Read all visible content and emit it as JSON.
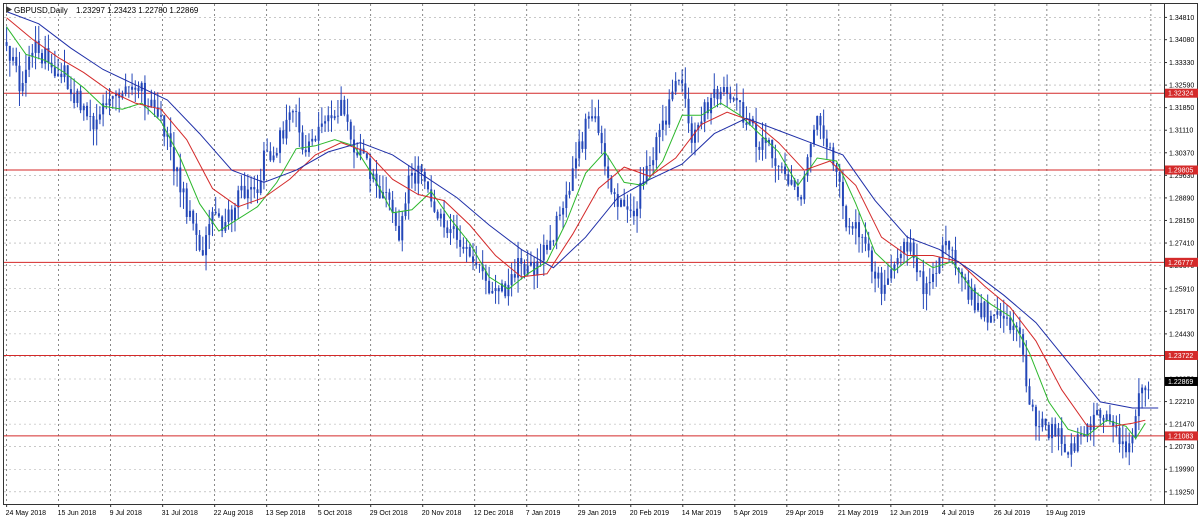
{
  "header": {
    "symbol": "GBPUSD,Daily",
    "ohlc": "1.23297 1.23423 1.22780 1.22869"
  },
  "colors": {
    "background": "#ffffff",
    "candle": "#2447b8",
    "ma_fast": "#2db82d",
    "ma_mid": "#d42a2a",
    "ma_slow": "#1f2fa8",
    "level_line": "#d42a2a",
    "level_tag": "#d42a2a",
    "current_tag": "#000000",
    "grid": "#a8a8a8"
  },
  "chart_data": {
    "type": "candlestick",
    "ylim": [
      1.1885,
      1.3525
    ],
    "y_ticks": [
      1.3481,
      1.3408,
      1.3333,
      1.3259,
      1.3185,
      1.3111,
      1.3037,
      1.2963,
      1.2889,
      1.2815,
      1.2741,
      1.2667,
      1.2591,
      1.2517,
      1.2443,
      1.2369,
      1.2295,
      1.2221,
      1.2147,
      1.2073,
      1.1999,
      1.1925
    ],
    "y_tick_labels": [
      "1.34810",
      "1.34080",
      "1.33330",
      "1.32590",
      "1.31850",
      "1.31110",
      "1.30370",
      "1.29630",
      "1.28890",
      "1.28150",
      "1.27410",
      "1.26670",
      "1.25910",
      "1.25170",
      "1.24430",
      "1.23690",
      "1.22950",
      "1.22210",
      "1.21470",
      "1.20730",
      "1.19990",
      "1.19250"
    ],
    "x_labels": [
      "24 May 2018",
      "15 Jun 2018",
      "9 Jul 2018",
      "31 Jul 2018",
      "22 Aug 2018",
      "13 Sep 2018",
      "5 Oct 2018",
      "29 Oct 2018",
      "20 Nov 2018",
      "12 Dec 2018",
      "7 Jan 2019",
      "29 Jan 2019",
      "20 Feb 2019",
      "14 Mar 2019",
      "5 Apr 2019",
      "29 Apr 2019",
      "21 May 2019",
      "12 Jun 2019",
      "4 Jul 2019",
      "26 Jul 2019",
      "19 Aug 2019"
    ],
    "horizontal_levels": [
      {
        "value": 1.32324,
        "label": "1.32324"
      },
      {
        "value": 1.29805,
        "label": "1.29805"
      },
      {
        "value": 1.26777,
        "label": "1.26777"
      },
      {
        "value": 1.23722,
        "label": "1.23722"
      },
      {
        "value": 1.21083,
        "label": "1.21083"
      }
    ],
    "current_price": {
      "value": 1.22869,
      "label": "1.22869"
    },
    "grid": true,
    "legend": "none",
    "series": [
      {
        "kind": "candles",
        "close_path": [
          [
            0,
            1.34
          ],
          [
            4,
            1.326
          ],
          [
            8,
            1.338
          ],
          [
            12,
            1.335
          ],
          [
            15,
            1.332
          ],
          [
            18,
            1.329
          ],
          [
            21,
            1.323
          ],
          [
            25,
            1.318
          ],
          [
            28,
            1.312
          ],
          [
            31,
            1.32
          ],
          [
            35,
            1.322
          ],
          [
            39,
            1.326
          ],
          [
            42,
            1.324
          ],
          [
            45,
            1.318
          ],
          [
            48,
            1.314
          ],
          [
            52,
            1.3
          ],
          [
            55,
            1.29
          ],
          [
            58,
            1.278
          ],
          [
            61,
            1.27
          ],
          [
            64,
            1.282
          ],
          [
            67,
            1.278
          ],
          [
            70,
            1.284
          ],
          [
            73,
            1.293
          ],
          [
            77,
            1.29
          ],
          [
            80,
            1.301
          ],
          [
            84,
            1.305
          ],
          [
            87,
            1.313
          ],
          [
            90,
            1.318
          ],
          [
            93,
            1.302
          ],
          [
            96,
            1.308
          ],
          [
            100,
            1.315
          ],
          [
            104,
            1.319
          ],
          [
            107,
            1.309
          ],
          [
            110,
            1.304
          ],
          [
            113,
            1.297
          ],
          [
            116,
            1.292
          ],
          [
            119,
            1.285
          ],
          [
            122,
            1.272
          ],
          [
            125,
            1.295
          ],
          [
            128,
            1.298
          ],
          [
            131,
            1.293
          ],
          [
            134,
            1.285
          ],
          [
            137,
            1.28
          ],
          [
            141,
            1.276
          ],
          [
            144,
            1.272
          ],
          [
            147,
            1.266
          ],
          [
            150,
            1.258
          ],
          [
            153,
            1.255
          ],
          [
            156,
            1.262
          ],
          [
            160,
            1.268
          ],
          [
            164,
            1.264
          ],
          [
            168,
            1.272
          ],
          [
            171,
            1.28
          ],
          [
            174,
            1.29
          ],
          [
            177,
            1.3
          ],
          [
            180,
            1.312
          ],
          [
            183,
            1.317
          ],
          [
            186,
            1.302
          ],
          [
            189,
            1.29
          ],
          [
            192,
            1.286
          ],
          [
            195,
            1.282
          ],
          [
            198,
            1.296
          ],
          [
            201,
            1.303
          ],
          [
            204,
            1.312
          ],
          [
            207,
            1.325
          ],
          [
            210,
            1.326
          ],
          [
            213,
            1.31
          ],
          [
            216,
            1.315
          ],
          [
            219,
            1.321
          ],
          [
            222,
            1.325
          ],
          [
            225,
            1.322
          ],
          [
            228,
            1.318
          ],
          [
            231,
            1.312
          ],
          [
            234,
            1.307
          ],
          [
            237,
            1.307
          ],
          [
            240,
            1.3
          ],
          [
            243,
            1.296
          ],
          [
            246,
            1.286
          ],
          [
            249,
            1.3
          ],
          [
            252,
            1.314
          ],
          [
            255,
            1.304
          ],
          [
            258,
            1.298
          ],
          [
            261,
            1.282
          ],
          [
            264,
            1.278
          ],
          [
            267,
            1.271
          ],
          [
            270,
            1.264
          ],
          [
            273,
            1.258
          ],
          [
            276,
            1.266
          ],
          [
            279,
            1.273
          ],
          [
            282,
            1.27
          ],
          [
            285,
            1.258
          ],
          [
            288,
            1.264
          ],
          [
            291,
            1.272
          ],
          [
            294,
            1.271
          ],
          [
            297,
            1.261
          ],
          [
            300,
            1.256
          ],
          [
            303,
            1.253
          ],
          [
            306,
            1.25
          ],
          [
            309,
            1.25
          ],
          [
            312,
            1.248
          ],
          [
            315,
            1.244
          ],
          [
            318,
            1.22
          ],
          [
            321,
            1.216
          ],
          [
            324,
            1.212
          ],
          [
            327,
            1.212
          ],
          [
            330,
            1.207
          ],
          [
            333,
            1.21
          ],
          [
            336,
            1.214
          ],
          [
            339,
            1.216
          ],
          [
            342,
            1.22
          ],
          [
            345,
            1.214
          ],
          [
            348,
            1.205
          ],
          [
            351,
            1.218
          ],
          [
            354,
            1.228
          ],
          [
            355,
            1.2287
          ]
        ]
      },
      {
        "kind": "moving_average_fast",
        "path": [
          [
            0,
            1.345
          ],
          [
            6,
            1.336
          ],
          [
            12,
            1.334
          ],
          [
            18,
            1.33
          ],
          [
            24,
            1.325
          ],
          [
            30,
            1.319
          ],
          [
            36,
            1.318
          ],
          [
            42,
            1.32
          ],
          [
            48,
            1.314
          ],
          [
            54,
            1.302
          ],
          [
            60,
            1.287
          ],
          [
            66,
            1.278
          ],
          [
            72,
            1.282
          ],
          [
            78,
            1.286
          ],
          [
            84,
            1.294
          ],
          [
            90,
            1.305
          ],
          [
            96,
            1.306
          ],
          [
            102,
            1.308
          ],
          [
            108,
            1.306
          ],
          [
            114,
            1.296
          ],
          [
            120,
            1.284
          ],
          [
            126,
            1.285
          ],
          [
            132,
            1.291
          ],
          [
            138,
            1.282
          ],
          [
            144,
            1.274
          ],
          [
            150,
            1.263
          ],
          [
            156,
            1.259
          ],
          [
            162,
            1.264
          ],
          [
            168,
            1.268
          ],
          [
            174,
            1.281
          ],
          [
            180,
            1.297
          ],
          [
            186,
            1.304
          ],
          [
            192,
            1.294
          ],
          [
            198,
            1.293
          ],
          [
            204,
            1.301
          ],
          [
            210,
            1.316
          ],
          [
            216,
            1.316
          ],
          [
            222,
            1.32
          ],
          [
            228,
            1.316
          ],
          [
            234,
            1.31
          ],
          [
            240,
            1.304
          ],
          [
            246,
            1.293
          ],
          [
            252,
            1.302
          ],
          [
            258,
            1.301
          ],
          [
            264,
            1.287
          ],
          [
            270,
            1.271
          ],
          [
            276,
            1.265
          ],
          [
            282,
            1.27
          ],
          [
            288,
            1.266
          ],
          [
            294,
            1.268
          ],
          [
            300,
            1.259
          ],
          [
            306,
            1.254
          ],
          [
            312,
            1.25
          ],
          [
            318,
            1.238
          ],
          [
            324,
            1.222
          ],
          [
            330,
            1.213
          ],
          [
            336,
            1.211
          ],
          [
            342,
            1.216
          ],
          [
            348,
            1.214
          ],
          [
            351,
            1.21
          ],
          [
            354,
            1.215
          ]
        ]
      },
      {
        "kind": "moving_average_mid",
        "path": [
          [
            0,
            1.348
          ],
          [
            8,
            1.341
          ],
          [
            16,
            1.335
          ],
          [
            24,
            1.33
          ],
          [
            32,
            1.324
          ],
          [
            40,
            1.32
          ],
          [
            48,
            1.318
          ],
          [
            56,
            1.308
          ],
          [
            64,
            1.292
          ],
          [
            72,
            1.286
          ],
          [
            80,
            1.289
          ],
          [
            88,
            1.295
          ],
          [
            96,
            1.303
          ],
          [
            104,
            1.307
          ],
          [
            112,
            1.304
          ],
          [
            120,
            1.295
          ],
          [
            128,
            1.29
          ],
          [
            136,
            1.288
          ],
          [
            144,
            1.28
          ],
          [
            152,
            1.27
          ],
          [
            160,
            1.263
          ],
          [
            168,
            1.264
          ],
          [
            176,
            1.277
          ],
          [
            184,
            1.292
          ],
          [
            192,
            1.299
          ],
          [
            200,
            1.296
          ],
          [
            208,
            1.302
          ],
          [
            216,
            1.313
          ],
          [
            224,
            1.317
          ],
          [
            232,
            1.314
          ],
          [
            240,
            1.307
          ],
          [
            248,
            1.298
          ],
          [
            256,
            1.301
          ],
          [
            264,
            1.293
          ],
          [
            272,
            1.276
          ],
          [
            280,
            1.27
          ],
          [
            288,
            1.27
          ],
          [
            296,
            1.268
          ],
          [
            304,
            1.26
          ],
          [
            312,
            1.253
          ],
          [
            320,
            1.242
          ],
          [
            328,
            1.226
          ],
          [
            336,
            1.214
          ],
          [
            344,
            1.214
          ],
          [
            350,
            1.215
          ],
          [
            354,
            1.216
          ]
        ]
      },
      {
        "kind": "moving_average_slow",
        "path": [
          [
            0,
            1.35
          ],
          [
            10,
            1.346
          ],
          [
            20,
            1.338
          ],
          [
            30,
            1.331
          ],
          [
            40,
            1.326
          ],
          [
            50,
            1.321
          ],
          [
            60,
            1.31
          ],
          [
            70,
            1.298
          ],
          [
            80,
            1.294
          ],
          [
            90,
            1.298
          ],
          [
            100,
            1.304
          ],
          [
            110,
            1.307
          ],
          [
            120,
            1.303
          ],
          [
            130,
            1.296
          ],
          [
            140,
            1.289
          ],
          [
            150,
            1.28
          ],
          [
            160,
            1.272
          ],
          [
            170,
            1.266
          ],
          [
            180,
            1.276
          ],
          [
            190,
            1.289
          ],
          [
            200,
            1.295
          ],
          [
            210,
            1.3
          ],
          [
            220,
            1.31
          ],
          [
            230,
            1.315
          ],
          [
            240,
            1.311
          ],
          [
            250,
            1.307
          ],
          [
            260,
            1.303
          ],
          [
            270,
            1.288
          ],
          [
            280,
            1.276
          ],
          [
            290,
            1.272
          ],
          [
            300,
            1.265
          ],
          [
            310,
            1.257
          ],
          [
            320,
            1.248
          ],
          [
            330,
            1.235
          ],
          [
            340,
            1.222
          ],
          [
            350,
            1.22
          ],
          [
            358,
            1.22
          ]
        ]
      }
    ]
  }
}
